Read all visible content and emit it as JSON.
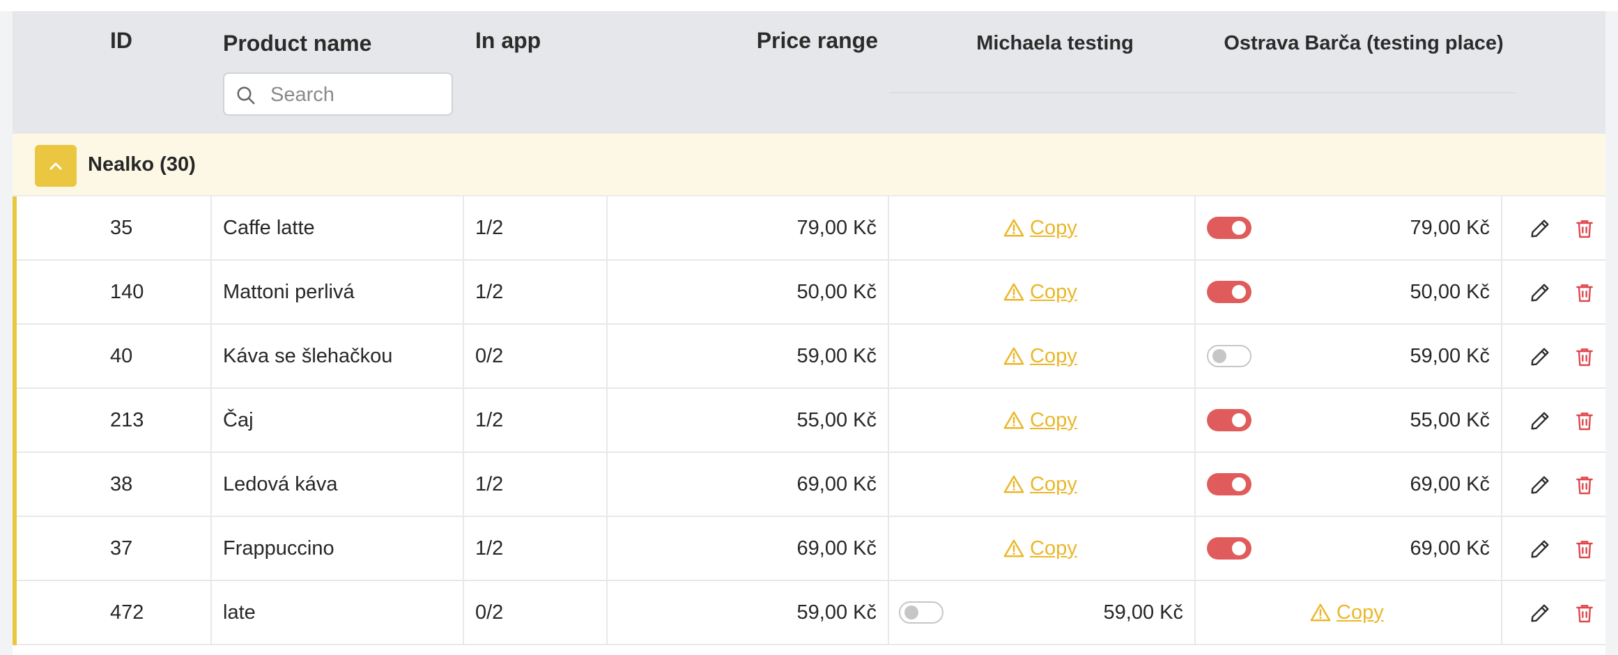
{
  "header": {
    "id": "ID",
    "product_name": "Product name",
    "in_app": "In app",
    "price_range": "Price range",
    "place1": "Michaela testing",
    "place2": "Ostrava Barča (testing place)"
  },
  "search": {
    "placeholder": "Search",
    "value": ""
  },
  "group": {
    "label": "Nealko (30)",
    "expanded": true
  },
  "copy_label": "Copy",
  "colors": {
    "accent_yellow": "#ebc641",
    "toggle_on": "#e05b5b",
    "warning": "#eab72a",
    "delete": "#e0474c",
    "header_bg": "#e6e7ea",
    "group_bg": "#fdf8e6"
  },
  "rows": [
    {
      "id": "35",
      "name": "Caffe latte",
      "in_app": "1/2",
      "price": "79,00 Kč",
      "michaela": "copy",
      "ostrava_toggle": true,
      "ostrava_price": "79,00 Kč"
    },
    {
      "id": "140",
      "name": "Mattoni perlivá",
      "in_app": "1/2",
      "price": "50,00 Kč",
      "michaela": "copy",
      "ostrava_toggle": true,
      "ostrava_price": "50,00 Kč"
    },
    {
      "id": "40",
      "name": "Káva se šlehačkou",
      "in_app": "0/2",
      "price": "59,00 Kč",
      "michaela": "copy",
      "ostrava_toggle": false,
      "ostrava_price": "59,00 Kč"
    },
    {
      "id": "213",
      "name": "Čaj",
      "in_app": "1/2",
      "price": "55,00 Kč",
      "michaela": "copy",
      "ostrava_toggle": true,
      "ostrava_price": "55,00 Kč"
    },
    {
      "id": "38",
      "name": "Ledová káva",
      "in_app": "1/2",
      "price": "69,00 Kč",
      "michaela": "copy",
      "ostrava_toggle": true,
      "ostrava_price": "69,00 Kč"
    },
    {
      "id": "37",
      "name": "Frappuccino",
      "in_app": "1/2",
      "price": "69,00 Kč",
      "michaela": "copy",
      "ostrava_toggle": true,
      "ostrava_price": "69,00 Kč"
    },
    {
      "id": "472",
      "name": "late",
      "in_app": "0/2",
      "price": "59,00 Kč",
      "michaela": "price",
      "michaela_toggle": false,
      "michaela_price": "59,00 Kč",
      "ostrava": "copy"
    }
  ],
  "icons": {
    "search": "search-icon",
    "collapse": "chevron-up-icon",
    "warning": "warning-icon",
    "edit": "pencil-icon",
    "delete": "trash-icon"
  }
}
